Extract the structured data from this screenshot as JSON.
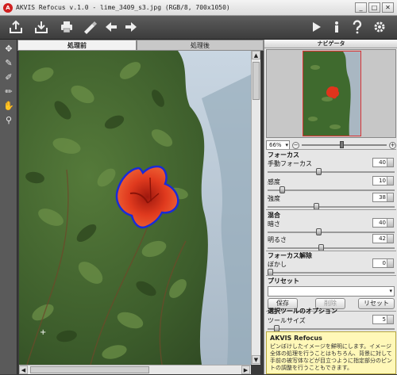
{
  "window": {
    "title": "AKVIS Refocus v.1.0 - lime_3409_s3.jpg (RGB/8, 700x1050)",
    "controls": {
      "minimize": "_",
      "maximize": "□",
      "close": "✕"
    }
  },
  "toolbar": {
    "left_icons": [
      "open-icon",
      "save-icon",
      "print-icon",
      "brush-settings-icon",
      "undo-icon",
      "redo-icon"
    ],
    "right_icons": [
      "run-icon",
      "info-icon",
      "help-icon",
      "settings-icon"
    ]
  },
  "tools": [
    "hand-selection-icon",
    "focus-brush-icon",
    "eraser-icon",
    "pencil-icon",
    "hand-icon",
    "zoom-icon"
  ],
  "tabs": {
    "before": "処理前",
    "after": "処理後"
  },
  "navigator": {
    "title": "ナビゲータ",
    "zoom": "66%"
  },
  "focus": {
    "title": "フォーカス",
    "params": [
      {
        "label": "手動フォーカス",
        "value": "40",
        "level": 0.4
      },
      {
        "label": "感度",
        "value": "10",
        "level": 0.1
      },
      {
        "label": "強度",
        "value": "38",
        "level": 0.38
      }
    ]
  },
  "mix": {
    "title": "混合",
    "params": [
      {
        "label": "暗さ",
        "value": "40",
        "level": 0.4
      },
      {
        "label": "明るさ",
        "value": "42",
        "level": 0.42
      }
    ]
  },
  "unfocus": {
    "title": "フォーカス解除",
    "params": [
      {
        "label": "ぼかし",
        "value": "0",
        "level": 0
      }
    ]
  },
  "preset": {
    "title": "プリセット",
    "save": "保存",
    "delete": "削除",
    "reset": "リセット"
  },
  "tool_options": {
    "title": "選択ツールのオプション",
    "params": [
      {
        "label": "ツールサイズ",
        "value": "5",
        "level": 0.05
      }
    ]
  },
  "help": {
    "title": "AKVIS Refocus",
    "body": "ピンぼけしたイメージを鮮明にします。イメージ全体の処理を行うことはもちろん、背景に対して手前の被写体などが目立つように指定部分のピントの調整を行うこともできます。"
  },
  "colors": {
    "selection_outline": "#1a2bd8",
    "flower": "#e0341c",
    "foliage": "#3f6a2e"
  }
}
